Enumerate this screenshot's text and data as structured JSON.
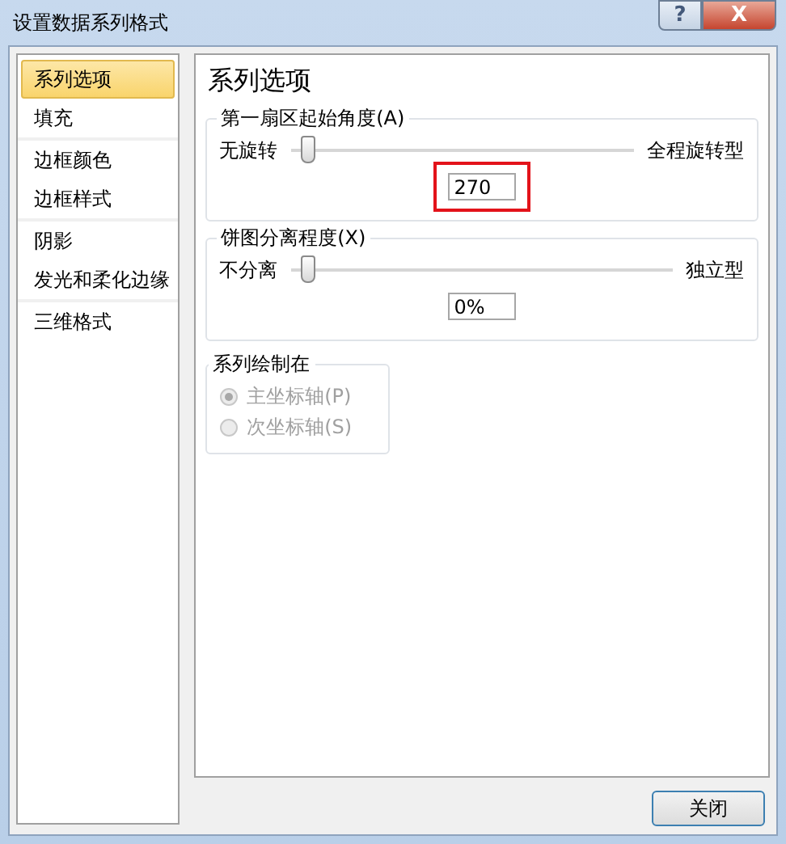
{
  "window": {
    "title": "设置数据系列格式",
    "help_button": "?",
    "close_button": "X"
  },
  "sidebar": {
    "items": [
      {
        "label": "系列选项",
        "selected": true,
        "separator_after": false
      },
      {
        "label": "填充",
        "selected": false,
        "separator_after": true
      },
      {
        "label": "边框颜色",
        "selected": false,
        "separator_after": false
      },
      {
        "label": "边框样式",
        "selected": false,
        "separator_after": true
      },
      {
        "label": "阴影",
        "selected": false,
        "separator_after": false
      },
      {
        "label": "发光和柔化边缘",
        "selected": false,
        "separator_after": true
      },
      {
        "label": "三维格式",
        "selected": false,
        "separator_after": false
      }
    ]
  },
  "panel": {
    "title": "系列选项",
    "slider_groups": [
      {
        "legend": "第一扇区起始角度(A)",
        "min_label": "无旋转",
        "max_label": "全程旋转型",
        "level": 0,
        "value": "270",
        "highlighted": true
      },
      {
        "legend": "饼图分离程度(X)",
        "min_label": "不分离",
        "max_label": "独立型",
        "level": 0,
        "value": "0%",
        "highlighted": false
      }
    ],
    "axis_group": {
      "legend": "系列绘制在",
      "disabled": true,
      "options": [
        {
          "label": "主坐标轴(P)",
          "selected": true
        },
        {
          "label": "次坐标轴(S)",
          "selected": false
        }
      ]
    }
  },
  "buttons": [
    {
      "label": "关闭"
    }
  ]
}
